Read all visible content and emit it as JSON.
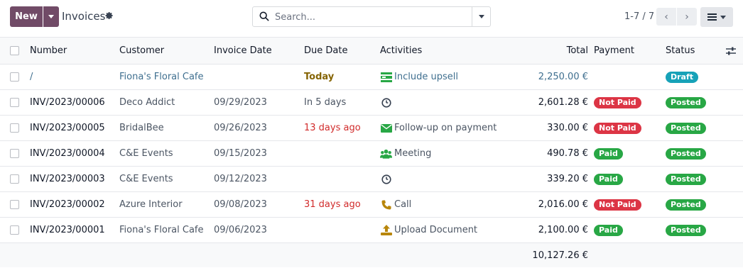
{
  "header": {
    "new_label": "New",
    "title": "Invoices",
    "search_placeholder": "Search...",
    "pager": "1-7 / 7"
  },
  "columns": {
    "number": "Number",
    "customer": "Customer",
    "invoice_date": "Invoice Date",
    "due_date": "Due Date",
    "activities": "Activities",
    "total": "Total",
    "payment": "Payment",
    "status": "Status"
  },
  "rows": [
    {
      "number": "/",
      "customer": "Fiona's Floral Cafe",
      "invoice_date": "",
      "due_date": "Today",
      "activity": "Include upsell",
      "activity_icon": "upsell-icon",
      "total": "2,250.00 €",
      "payment": "",
      "status": "Draft"
    },
    {
      "number": "INV/2023/00006",
      "customer": "Deco Addict",
      "invoice_date": "09/29/2023",
      "due_date": "In 5 days",
      "activity": "",
      "activity_icon": "clock-icon",
      "total": "2,601.28 €",
      "payment": "Not Paid",
      "status": "Posted"
    },
    {
      "number": "INV/2023/00005",
      "customer": "BridalBee",
      "invoice_date": "09/26/2023",
      "due_date": "13 days ago",
      "activity": "Follow-up on payment",
      "activity_icon": "envelope-icon",
      "total": "330.00 €",
      "payment": "Not Paid",
      "status": "Posted"
    },
    {
      "number": "INV/2023/00004",
      "customer": "C&E Events",
      "invoice_date": "09/15/2023",
      "due_date": "",
      "activity": "Meeting",
      "activity_icon": "users-icon",
      "total": "490.78 €",
      "payment": "Paid",
      "status": "Posted"
    },
    {
      "number": "INV/2023/00003",
      "customer": "C&E Events",
      "invoice_date": "09/12/2023",
      "due_date": "",
      "activity": "",
      "activity_icon": "clock-icon",
      "total": "339.20 €",
      "payment": "Paid",
      "status": "Posted"
    },
    {
      "number": "INV/2023/00002",
      "customer": "Azure Interior",
      "invoice_date": "09/08/2023",
      "due_date": "31 days ago",
      "activity": "Call",
      "activity_icon": "phone-icon",
      "total": "2,016.00 €",
      "payment": "Not Paid",
      "status": "Posted"
    },
    {
      "number": "INV/2023/00001",
      "customer": "Fiona's Floral Cafe",
      "invoice_date": "09/06/2023",
      "due_date": "",
      "activity": "Upload Document",
      "activity_icon": "upload-icon",
      "total": "2,100.00 €",
      "payment": "Paid",
      "status": "Posted"
    }
  ],
  "footer": {
    "total": "10,127.26 €"
  },
  "colors": {
    "brand": "#714B67",
    "draft": "#17a2b8",
    "posted": "#28a745",
    "not_paid": "#dc3545",
    "link": "#3f6f8f",
    "activity_green": "#28a745",
    "activity_orange": "#b8860b"
  }
}
